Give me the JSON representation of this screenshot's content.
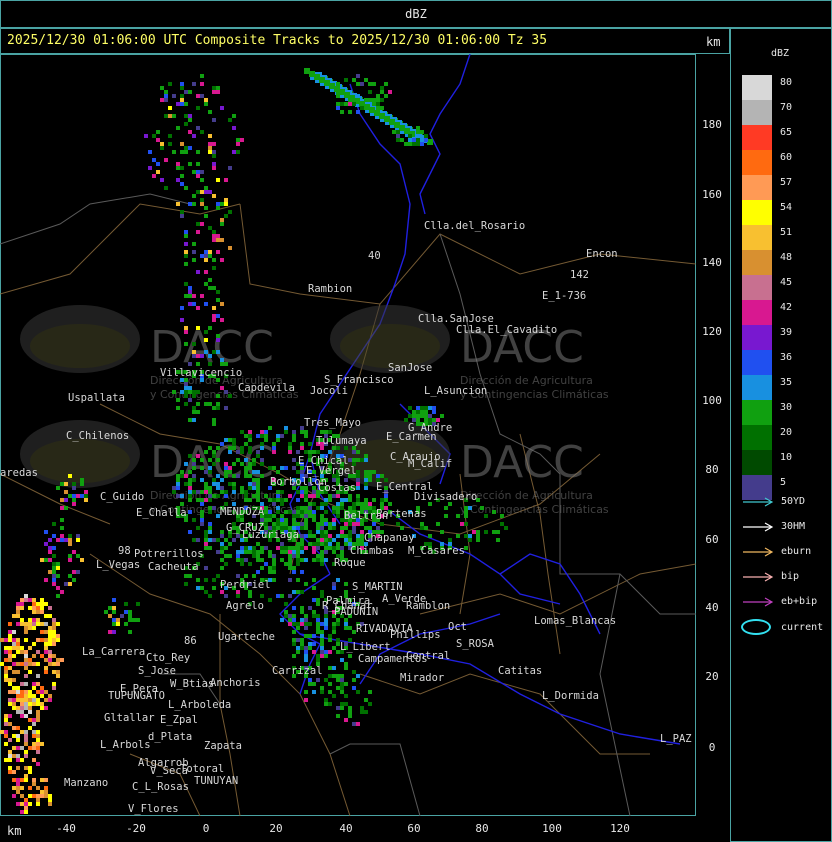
{
  "top_title": "dBZ",
  "title": "2025/12/30 01:06:00 UTC Composite Tracks to 2025/12/30 01:06:00 Tz 35",
  "km_label": "km",
  "y_ticks": [
    "180",
    "160",
    "140",
    "120",
    "100",
    "80",
    "60",
    "40",
    "20",
    "0"
  ],
  "x_ticks": [
    "-40",
    "-20",
    "0",
    "20",
    "40",
    "60",
    "80",
    "100",
    "120"
  ],
  "legend": {
    "title": "dBZ",
    "scale": [
      {
        "label": "80",
        "color": "#d8d8d8"
      },
      {
        "label": "70",
        "color": "#b4b4b4"
      },
      {
        "label": "65",
        "color": "#ff3a24"
      },
      {
        "label": "60",
        "color": "#ff6a10"
      },
      {
        "label": "57",
        "color": "#ff9a55"
      },
      {
        "label": "54",
        "color": "#ffff00"
      },
      {
        "label": "51",
        "color": "#f8c030"
      },
      {
        "label": "48",
        "color": "#d89030"
      },
      {
        "label": "45",
        "color": "#c87090"
      },
      {
        "label": "42",
        "color": "#d81890"
      },
      {
        "label": "39",
        "color": "#7818d0"
      },
      {
        "label": "36",
        "color": "#2050f0"
      },
      {
        "label": "35",
        "color": "#1890e0"
      },
      {
        "label": "30",
        "color": "#10a010"
      },
      {
        "label": "20",
        "color": "#007000"
      },
      {
        "label": "10",
        "color": "#004a00"
      },
      {
        "label": "5",
        "color": "#443c8c"
      }
    ],
    "tracks": [
      {
        "label": "50YD",
        "color": "#40c8d0"
      },
      {
        "label": "30HM",
        "color": "#ffffff"
      },
      {
        "label": "eburn",
        "color": "#f0b860"
      },
      {
        "label": "bip",
        "color": "#f8b0b0"
      },
      {
        "label": "eb+bip",
        "color": "#c040c0"
      }
    ],
    "current_label": "current",
    "current_color": "#33e0f0"
  },
  "watermark": {
    "brand": "DACC",
    "line1": "Dirección de Agricultura",
    "line2": "y Contingencias Climáticas"
  },
  "places": [
    {
      "name": "Clla.del_Rosario"
    },
    {
      "name": "Encon"
    },
    {
      "name": "142"
    },
    {
      "name": "E_1-736"
    },
    {
      "name": "Rambion"
    },
    {
      "name": "Clla.SanJose"
    },
    {
      "name": "Clla.El_Cavadito"
    },
    {
      "name": "Villavicencio"
    },
    {
      "name": "Uspallata"
    },
    {
      "name": "C_Chilenos"
    },
    {
      "name": "S_Francisco"
    },
    {
      "name": "Jocoli"
    },
    {
      "name": "SanJose"
    },
    {
      "name": "L_Asuncion"
    },
    {
      "name": "Tres_Mayo"
    },
    {
      "name": "Tulumaya"
    },
    {
      "name": "E_Carmen"
    },
    {
      "name": "G_Andre"
    },
    {
      "name": "E_Chical"
    },
    {
      "name": "E_Vergel"
    },
    {
      "name": "C_Araujo"
    },
    {
      "name": "M_Calif"
    },
    {
      "name": "Capdevila"
    },
    {
      "name": "Borbollon"
    },
    {
      "name": "Costas"
    },
    {
      "name": "E_Central"
    },
    {
      "name": "Divisadero"
    },
    {
      "name": "C_Guido"
    },
    {
      "name": "E_Challa"
    },
    {
      "name": "MENDOZA"
    },
    {
      "name": "G_CRUZ"
    },
    {
      "name": "Luzuriaga"
    },
    {
      "name": "Portenas"
    },
    {
      "name": "Beltran"
    },
    {
      "name": "Chapanay"
    },
    {
      "name": "Chimbas"
    },
    {
      "name": "M_Casares"
    },
    {
      "name": "Potrerillos"
    },
    {
      "name": "L_Vegas"
    },
    {
      "name": "Cacheuta"
    },
    {
      "name": "Perdriel"
    },
    {
      "name": "Agrelo"
    },
    {
      "name": "S_MARTIN"
    },
    {
      "name": "Roque"
    },
    {
      "name": "Palmira"
    },
    {
      "name": "A_Verde"
    },
    {
      "name": "Ramblon"
    },
    {
      "name": "R_Chanar"
    },
    {
      "name": "PADUNIN"
    },
    {
      "name": "Ugarteche"
    },
    {
      "name": "RIVADAVIA"
    },
    {
      "name": "Phillips"
    },
    {
      "name": "Oct"
    },
    {
      "name": "Lomas_Blancas"
    },
    {
      "name": "L_Libert"
    },
    {
      "name": "S_ROSA"
    },
    {
      "name": "Campamentos"
    },
    {
      "name": "Central"
    },
    {
      "name": "La_Carrera"
    },
    {
      "name": "Cto_Rey"
    },
    {
      "name": "S_Jose"
    },
    {
      "name": "Carrizal"
    },
    {
      "name": "Catitas"
    },
    {
      "name": "E_Pera"
    },
    {
      "name": "TUPUNGATO"
    },
    {
      "name": "W_Btias"
    },
    {
      "name": "Anchoris"
    },
    {
      "name": "Mirador"
    },
    {
      "name": "L_Dormida"
    },
    {
      "name": "L_Arboleda"
    },
    {
      "name": "Gltallar"
    },
    {
      "name": "E_Zpal"
    },
    {
      "name": "d_Plata"
    },
    {
      "name": "L_Arbols"
    },
    {
      "name": "Zapata"
    },
    {
      "name": "Algarrob"
    },
    {
      "name": "V_Seca"
    },
    {
      "name": "Totoral"
    },
    {
      "name": "TUNUYAN"
    },
    {
      "name": "Manzano"
    },
    {
      "name": "C_L_Rosas"
    },
    {
      "name": "V_Flores"
    },
    {
      "name": "L_PAZ"
    },
    {
      "name": "aredas"
    },
    {
      "name": "98"
    },
    {
      "name": "86"
    },
    {
      "name": "40"
    }
  ]
}
